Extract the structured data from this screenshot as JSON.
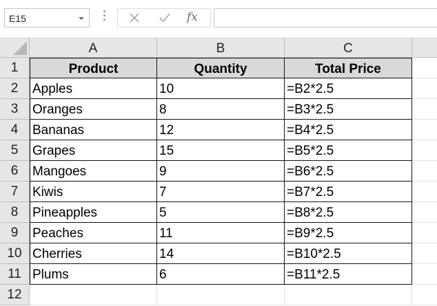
{
  "formula_bar": {
    "name_box": "E15",
    "fx_label": "fx",
    "formula": ""
  },
  "columns": [
    "A",
    "B",
    "C"
  ],
  "row_numbers": [
    "1",
    "2",
    "3",
    "4",
    "5",
    "6",
    "7",
    "8",
    "9",
    "10",
    "11",
    "12"
  ],
  "table": {
    "headers": [
      "Product",
      "Quantity",
      "Total Price"
    ],
    "rows": [
      [
        "Apples",
        "10",
        "=B2*2.5"
      ],
      [
        "Oranges",
        "8",
        "=B3*2.5"
      ],
      [
        "Bananas",
        "12",
        "=B4*2.5"
      ],
      [
        "Grapes",
        "15",
        "=B5*2.5"
      ],
      [
        "Mangoes",
        "9",
        "=B6*2.5"
      ],
      [
        "Kiwis",
        "7",
        "=B7*2.5"
      ],
      [
        "Pineapples",
        "5",
        "=B8*2.5"
      ],
      [
        "Peaches",
        "11",
        "=B9*2.5"
      ],
      [
        "Cherries",
        "14",
        "=B10*2.5"
      ],
      [
        "Plums",
        "6",
        "=B11*2.5"
      ]
    ]
  },
  "colors": {
    "header_fill": "#d9d9d9",
    "grid_header_fill": "#e6e6e6"
  }
}
